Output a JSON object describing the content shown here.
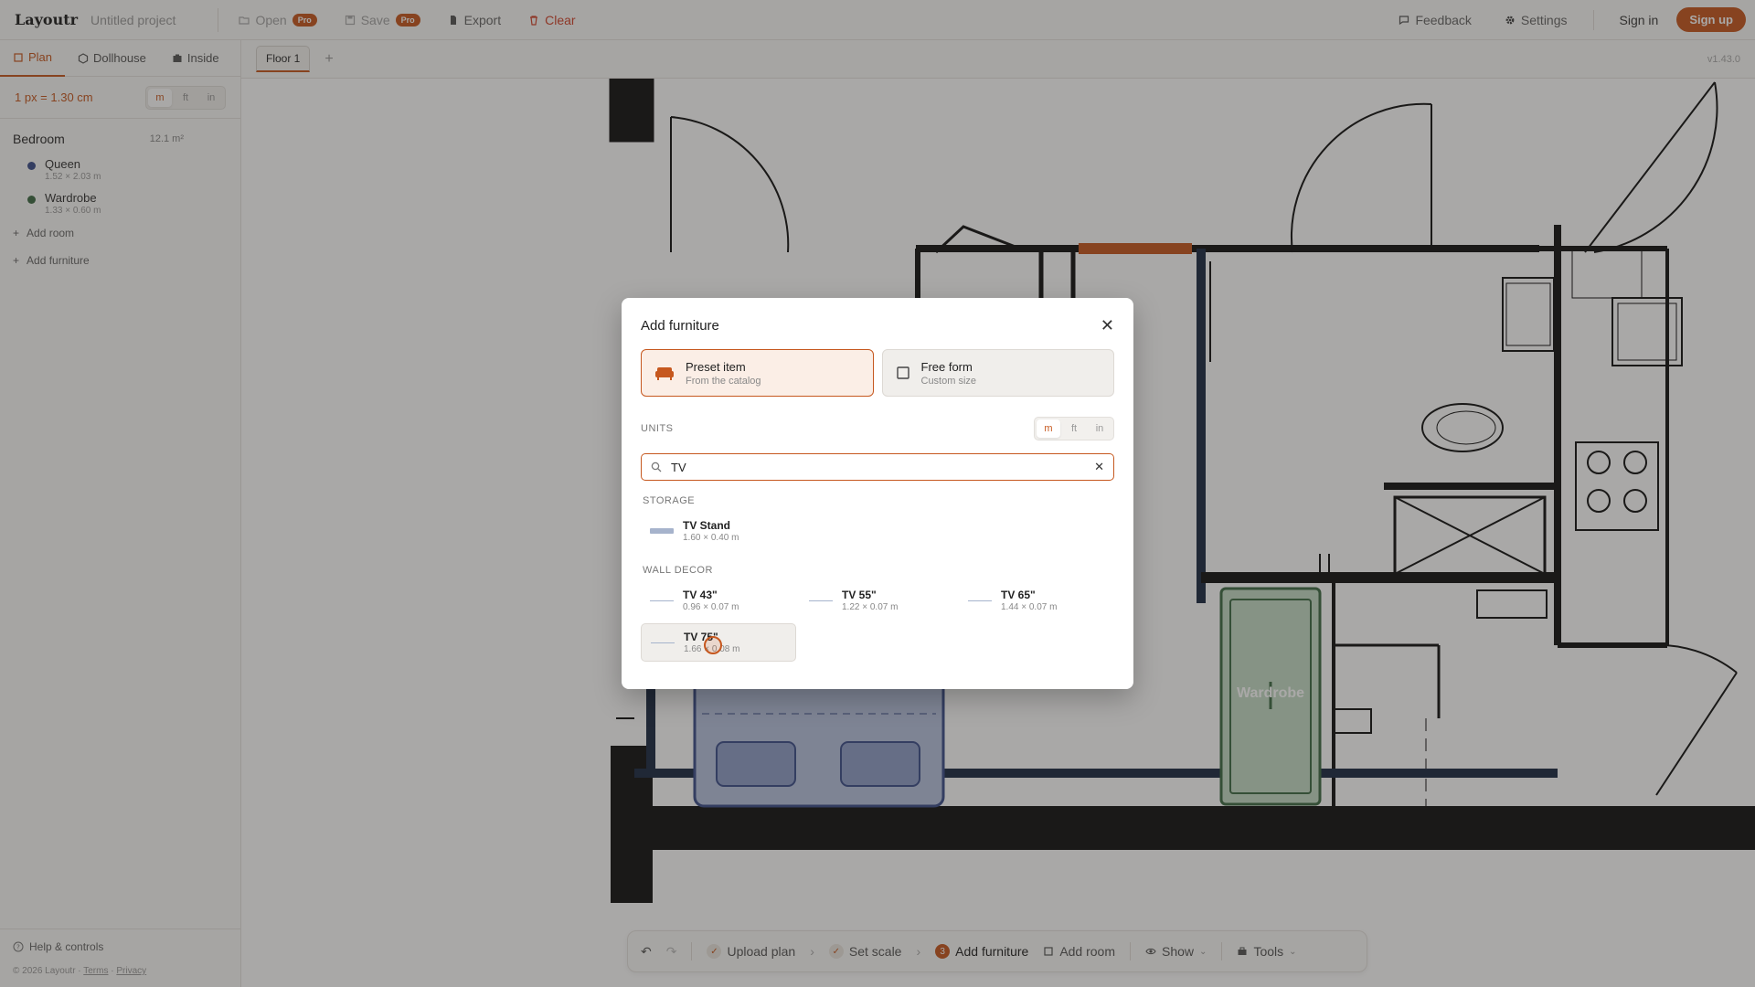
{
  "app": {
    "brand": "Layoutr",
    "project": "Untitled project",
    "version": "v1.43.0"
  },
  "topbar": {
    "open_label": "Open",
    "save_label": "Save",
    "pro_badge": "Pro",
    "export_label": "Export",
    "clear_label": "Clear",
    "feedback_label": "Feedback",
    "settings_label": "Settings",
    "signin_label": "Sign in",
    "signup_label": "Sign up"
  },
  "sidebar": {
    "tabs": [
      {
        "label": "Plan"
      },
      {
        "label": "Dollhouse"
      },
      {
        "label": "Inside"
      }
    ],
    "scale_label": "1 px = 1.30 cm",
    "units": [
      "m",
      "ft",
      "in"
    ],
    "room": {
      "name": "Bedroom",
      "area": "12.1 m²"
    },
    "items": [
      {
        "name": "Queen",
        "dims": "1.52 × 2.03 m",
        "color": "#3d4f8a"
      },
      {
        "name": "Wardrobe",
        "dims": "1.33 × 0.60 m",
        "color": "#3f6b45"
      }
    ],
    "add_room_label": "Add room",
    "add_furniture_label": "Add furniture",
    "help_label": "Help & controls",
    "copyright": "© 2026 Layoutr ·",
    "terms_label": "Terms",
    "privacy_label": "Privacy"
  },
  "floors": {
    "tabs": [
      {
        "label": "Floor 1"
      }
    ]
  },
  "canvas": {
    "wardrobe_label": "Wardrobe"
  },
  "bottombar": {
    "upload_label": "Upload plan",
    "scale_label": "Set scale",
    "step_number": "3",
    "add_furniture_label": "Add furniture",
    "add_room_label": "Add room",
    "show_label": "Show",
    "tools_label": "Tools"
  },
  "modal": {
    "title": "Add furniture",
    "modes": [
      {
        "title": "Preset item",
        "subtitle": "From the catalog"
      },
      {
        "title": "Free form",
        "subtitle": "Custom size"
      }
    ],
    "units_label": "UNITS",
    "units": [
      "m",
      "ft",
      "in"
    ],
    "search_value": "TV",
    "categories": [
      {
        "name": "STORAGE",
        "items": [
          {
            "name": "TV Stand",
            "dims": "1.60 × 0.40 m"
          }
        ]
      },
      {
        "name": "WALL DECOR",
        "items": [
          {
            "name": "TV 43\"",
            "dims": "0.96 × 0.07 m"
          },
          {
            "name": "TV 55\"",
            "dims": "1.22 × 0.07 m"
          },
          {
            "name": "TV 65\"",
            "dims": "1.44 × 0.07 m"
          },
          {
            "name": "TV 75\"",
            "dims": "1.66 × 0.08 m"
          }
        ]
      }
    ]
  },
  "colors": {
    "accent": "#c6581f",
    "danger": "#d2442c",
    "wardrobe": "#3f6b45",
    "bed": "#3d4f8a"
  }
}
